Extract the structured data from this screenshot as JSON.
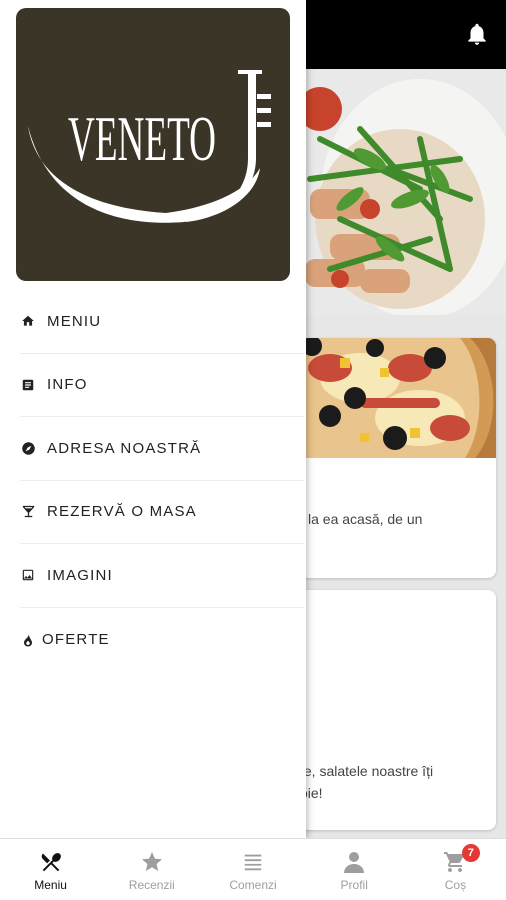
{
  "brand": {
    "name": "VENETO",
    "logo_bg": "#3a3527",
    "logo_fg": "#ffffff"
  },
  "drawer": {
    "items": [
      {
        "label": "MENIU",
        "icon": "home-icon"
      },
      {
        "label": "INFO",
        "icon": "info-list-icon"
      },
      {
        "label": "ADRESA NOASTRĂ",
        "icon": "compass-icon"
      },
      {
        "label": "REZERVĂ O MASA",
        "icon": "cocktail-icon"
      },
      {
        "label": "IMAGINI",
        "icon": "image-icon"
      },
      {
        "label": "OFERTE",
        "icon": "flame-icon"
      }
    ]
  },
  "background": {
    "card2_text_line1": "la ea acasă, de un",
    "card3_text_line1": "te, salatele noastre îți",
    "card3_text_line2": "oie!"
  },
  "bottom_nav": {
    "items": [
      {
        "label": "Meniu",
        "icon": "fork-knife-icon",
        "active": true
      },
      {
        "label": "Recenzii",
        "icon": "star-icon",
        "active": false
      },
      {
        "label": "Comenzi",
        "icon": "list-icon",
        "active": false
      },
      {
        "label": "Profil",
        "icon": "person-icon",
        "active": false
      },
      {
        "label": "Coș",
        "icon": "cart-icon",
        "active": false
      }
    ],
    "cart_count": "7"
  },
  "colors": {
    "appbar": "#000000",
    "badge": "#e53935",
    "inactive": "#9e9e9e"
  }
}
